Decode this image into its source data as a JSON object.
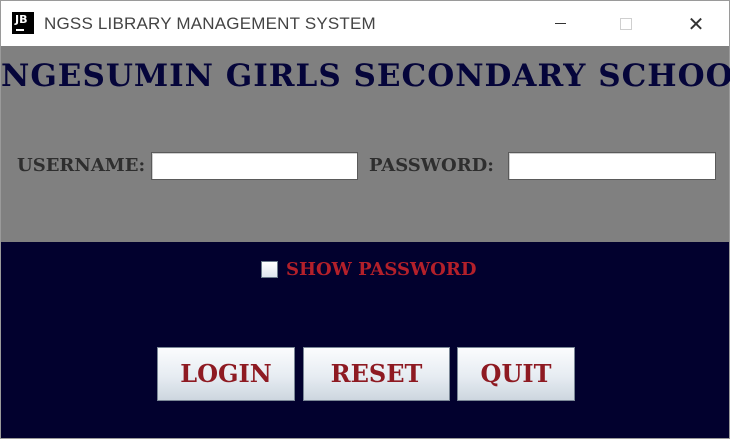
{
  "window": {
    "icon_text": "JB",
    "title": "NGSS LIBRARY MANAGEMENT SYSTEM",
    "controls": [
      "minimize-icon",
      "maximize-icon",
      "close-icon"
    ],
    "close_glyph": "✕"
  },
  "header": {
    "school_name": "NGESUMIN GIRLS SECONDARY SCHOOL"
  },
  "form": {
    "username_label": "USERNAME:",
    "username_value": "",
    "password_label": "PASSWORD:",
    "password_value": "",
    "show_password_label": "SHOW PASSWORD",
    "show_password_checked": false
  },
  "buttons": {
    "login": "LOGIN",
    "reset": "RESET",
    "quit": "QUIT"
  },
  "colors": {
    "top_panel": "#808080",
    "bottom_panel": "#02012e",
    "title_text": "#05053a",
    "accent_red": "#b3202a"
  }
}
